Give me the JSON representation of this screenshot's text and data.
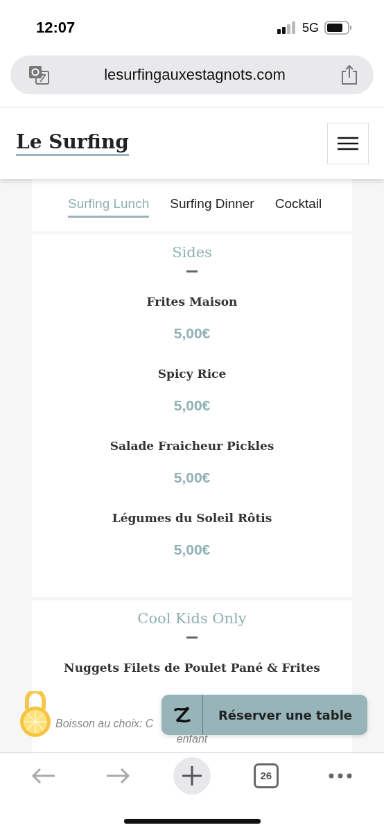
{
  "status_bar": {
    "time": "12:07",
    "network": "5G"
  },
  "browser": {
    "url": "lesurfingauxestagnots.com",
    "tab_count": "26"
  },
  "site": {
    "logo": "Le Surfing"
  },
  "tabs": [
    {
      "label": "Surfing Lunch",
      "selected": true
    },
    {
      "label": "Surfing Dinner",
      "selected": false
    },
    {
      "label": "Cocktail",
      "selected": false
    }
  ],
  "sections": [
    {
      "title": "Sides",
      "items": [
        {
          "name": "Frites Maison",
          "price": "5,00€"
        },
        {
          "name": "Spicy Rice",
          "price": "5,00€"
        },
        {
          "name": "Salade Fraicheur Pickles",
          "price": "5,00€"
        },
        {
          "name": "Légumes du Soleil Rôtis",
          "price": "5,00€"
        }
      ]
    },
    {
      "title": "Cool Kids Only",
      "items": [
        {
          "name": "Nuggets Filets de Poulet Pané & Frites",
          "description": [
            "Boisson au choix: C",
            "enfant"
          ]
        }
      ]
    }
  ],
  "reserve_button": {
    "label": "Réserver une table"
  }
}
